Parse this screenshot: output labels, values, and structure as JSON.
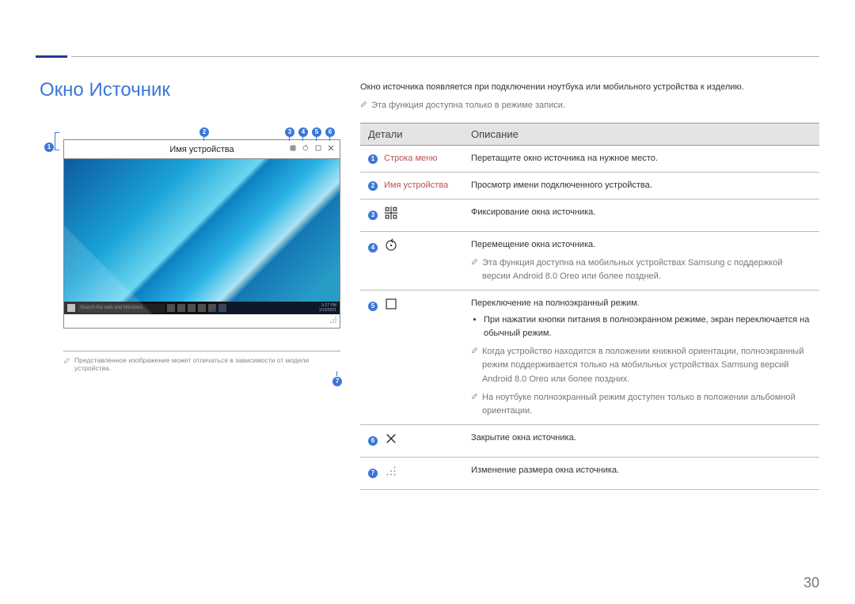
{
  "page": {
    "title": "Окно Источник",
    "intro": "Окно источника появляется при подключении ноутбука или мобильного устройства к изделию.",
    "intro_note": "Эта функция доступна только в режиме записи.",
    "page_number": "30"
  },
  "figure": {
    "device_name": "Имя устройства",
    "search_placeholder": "Search the web and Windows",
    "caption": "Представленное изображение может отличаться в зависимости от модели устройства.",
    "callouts": {
      "n1": "1",
      "n2": "2",
      "n3": "3",
      "n4": "4",
      "n5": "5",
      "n6": "6",
      "n7": "7"
    }
  },
  "table": {
    "head_details": "Детали",
    "head_desc": "Описание",
    "rows": {
      "r1": {
        "num": "1",
        "label": "Строка меню",
        "desc": "Перетащите окно источника на нужное место."
      },
      "r2": {
        "num": "2",
        "label": "Имя устройства",
        "desc": "Просмотр имени подключенного устройства."
      },
      "r3": {
        "num": "3",
        "desc": "Фиксирование окна источника."
      },
      "r4": {
        "num": "4",
        "desc": "Перемещение окна источника.",
        "note": "Эта функция доступна на мобильных устройствах Samsung с поддержкой версии Android 8.0 Oreo или более поздней."
      },
      "r5": {
        "num": "5",
        "desc": "Переключение на полноэкранный режим.",
        "bullet": "При нажатии кнопки питания в полноэкранном режиме, экран переключается на обычный режим.",
        "note1": "Когда устройство находится в положении книжной ориентации, полноэкранный режим поддерживается только на мобильных устройствах Samsung версий Android 8.0 Oreo или более поздних.",
        "note2": "На ноутбуке полноэкранный режим доступен только в положении альбомной ориентации."
      },
      "r6": {
        "num": "6",
        "desc": "Закрытие окна источника."
      },
      "r7": {
        "num": "7",
        "desc": "Изменение размера окна источника."
      }
    }
  }
}
